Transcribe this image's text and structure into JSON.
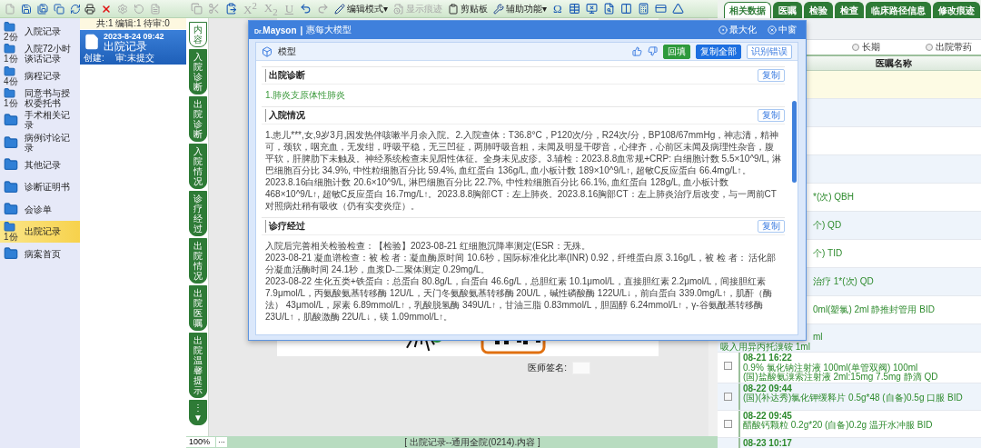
{
  "left_toolbar": [
    {
      "disabled": true
    },
    {
      "disabled": false
    },
    {
      "disabled": false
    },
    {
      "disabled": false
    },
    {
      "disabled": false
    },
    {
      "disabled": false
    },
    {
      "disabled": false
    },
    {
      "disabled": true
    },
    {
      "disabled": true
    },
    {
      "disabled": true
    }
  ],
  "sidebar": {
    "items": [
      {
        "label": "入院记录",
        "count": "2份",
        "selected": false
      },
      {
        "label": "入院72小时谈话记录",
        "count": "1份",
        "selected": false
      },
      {
        "label": "病程记录",
        "count": "4份",
        "selected": false
      },
      {
        "label": "同意书与授权委托书",
        "count": "1份",
        "selected": false
      },
      {
        "label": "手术相关记录",
        "selected": false
      },
      {
        "label": "病例讨论记录",
        "selected": false
      },
      {
        "label": "其他记录",
        "selected": false
      },
      {
        "label": "诊断证明书",
        "selected": false
      },
      {
        "label": "会诊单",
        "selected": false
      },
      {
        "label": "出院记录",
        "count": "1份",
        "selected": true
      },
      {
        "label": "病案首页",
        "selected": false
      }
    ]
  },
  "record_list": {
    "summary": "共:1 编辑:1 待审:0",
    "cards": [
      {
        "time": "2023-8-24 09:42",
        "title": "出院记录",
        "creator": "创建:",
        "status": "审:未提交",
        "selected": true
      }
    ]
  },
  "editor_toolbar": {
    "items": [
      {
        "kind": "icon",
        "disabled": true
      },
      {
        "kind": "icon",
        "disabled": true
      },
      {
        "kind": "icon",
        "disabled": false
      },
      {
        "kind": "glyph",
        "text": "X$^{2}$",
        "disabled": true
      },
      {
        "kind": "glyph",
        "text": "X$_{2}$",
        "disabled": true
      },
      {
        "kind": "glyph",
        "text": "U",
        "underlined": true,
        "disabled": true
      },
      {
        "kind": "icon",
        "disabled": false
      },
      {
        "kind": "icon",
        "disabled": true
      },
      {
        "kind": "menu",
        "text": "编辑模式",
        "arrow": "▾",
        "disabled": false
      },
      {
        "kind": "labeled",
        "text": "显示痕迹",
        "disabled": true
      },
      {
        "kind": "labeled",
        "text": "剪贴板",
        "disabled": false
      },
      {
        "kind": "menu",
        "text": "辅助功能",
        "arrow": "▾",
        "disabled": false
      },
      {
        "kind": "glyph",
        "text": "Ω",
        "disabled": false
      },
      {
        "kind": "icon",
        "disabled": false
      },
      {
        "kind": "icon",
        "disabled": false
      },
      {
        "kind": "icon",
        "disabled": false
      },
      {
        "kind": "icon",
        "disabled": false
      },
      {
        "kind": "icon",
        "disabled": false
      },
      {
        "kind": "icon",
        "disabled": false
      },
      {
        "kind": "icon",
        "disabled": false
      }
    ]
  },
  "section_tabs": [
    {
      "label": "内容",
      "selected": true
    },
    {
      "label": "入院诊断",
      "selected": false
    },
    {
      "label": "出院诊断",
      "selected": false
    },
    {
      "label": "入院情况",
      "selected": false
    },
    {
      "label": "诊疗经过",
      "selected": false
    },
    {
      "label": "出院情况",
      "selected": false
    },
    {
      "label": "出院医嘱",
      "selected": false
    },
    {
      "label": "出院温馨提示",
      "selected": false
    },
    {
      "label": "⋮▼",
      "selected": false
    }
  ],
  "document": {
    "signature_label": "医师签名:"
  },
  "status_bar": {
    "zoom": "100%",
    "zoom_menu": "···",
    "caption": "[ 出院记录--通用全院(0214).内容 ]"
  },
  "assistant": {
    "brand_prefix": "Dr.",
    "brand": "Mayson",
    "separator": "|",
    "title": "惠每大模型",
    "window_buttons": [
      {
        "label": "最大化",
        "kind": "maximize"
      },
      {
        "label": "中窗",
        "kind": "close"
      }
    ],
    "panel_title": "模型",
    "actions": [
      {
        "label": "回填",
        "kind": "fill"
      },
      {
        "label": "复制全部",
        "kind": "primary"
      },
      {
        "label": "识别错误",
        "kind": "outline"
      }
    ],
    "sections": [
      {
        "title": "出院诊断",
        "copy": "复制",
        "kind": "diagnosis",
        "paragraphs": [
          "1.肺炎支原体性肺炎"
        ]
      },
      {
        "title": "入院情况",
        "copy": "复制",
        "kind": "text",
        "paragraphs": [
          "1.患儿***,女,9岁3月,因发热伴咳嗽半月余入院。2.入院查体：T36.8°C，P120次/分，R24次/分，BP108/67mmHg，神志清，精神可，颈软，咽充血，无发绀，呼吸平稳，无三凹征，两肺呼吸音粗，未闻及明显干啰音，心律齐，心前区未闻及病理性杂音，腹平软，肝脾肋下未触及。神经系统检查未见阳性体征。全身未见皮疹。3.辅检：2023.8.8血常规+CRP: 白细胞计数 5.5×10^9/L, 淋巴细胞百分比 34.9%, 中性粒细胞百分比 59.4%, 血红蛋白 136g/L, 血小板计数 189×10^9/L↑, 超敏C反应蛋白 66.4mg/L↑。2023.8.16白细胞计数 20.6×10^9/L, 淋巴细胞百分比 22.7%, 中性粒细胞百分比 66.1%, 血红蛋白 128g/L, 血小板计数 468×10^9/L↑, 超敏C反应蛋白 16.7mg/L↑。2023.8.8胸部CT：左上肺炎。2023.8.16胸部CT：左上肺炎治疗后改变，与一周前CT对照病灶稍有吸收（仍有实变炎症）。"
        ]
      },
      {
        "title": "诊疗经过",
        "copy": "复制",
        "kind": "text",
        "paragraphs": [
          "入院后完善相关检验检查：【检验】2023-08-21 红细胞沉降率测定(ESR：无殊。",
          "2023-08-21 凝血谱检查：被 检 者：凝血酶原时间 10.6秒，国际标准化比率(INR) 0.92，纤维蛋白原 3.16g/L，被 检 者： 活化部分凝血活酶时间 24.1秒，血浆D-二聚体测定 0.29mg/L。",
          "2023-08-22 生化五类+铁蛋白：总蛋白 80.8g/L，白蛋白 46.6g/L，总胆红素 10.1μmol/L，直接胆红素 2.2μmol/L，间接胆红素 7.9μmol/L，丙氨酸氨基转移酶 12U/L，天门冬氨酸氨基转移酶 20U/L，碱性磷酸酶 122U/L↓，前白蛋白 339.0mg/L↑，肌酐（酶法） 43μmol/L，尿素 6.89mmol/L↑，乳酸脱氢酶 349U/L↑，甘油三脂 0.83mmol/L，胆固醇 6.24mmol/L↑，γ-谷氨酰基转移酶 23U/L↑，肌酸激酶 22U/L↓，镁 1.09mmol/L↑。"
        ]
      }
    ]
  },
  "right_panel": {
    "tabs": [
      {
        "label": "相关数据",
        "selected": true
      },
      {
        "label": "医嘱",
        "selected": false
      },
      {
        "label": "检验",
        "selected": false
      },
      {
        "label": "检查",
        "selected": false
      },
      {
        "label": "临床路径信息",
        "selected": false
      },
      {
        "label": "修改痕迹",
        "selected": false
      }
    ],
    "filters": [
      {
        "label": "长期",
        "selected": false
      },
      {
        "label": "出院带药",
        "selected": false
      }
    ],
    "column": "医嘱名称",
    "rows": [
      {
        "kind": "empty",
        "highlighted": true
      },
      {
        "kind": "empty",
        "highlighted": false
      },
      {
        "kind": "empty",
        "highlighted": false
      },
      {
        "kind": "empty",
        "highlighted": false
      },
      {
        "kind": "partial",
        "lines": [
          "*(次) QBH"
        ]
      },
      {
        "kind": "partial",
        "lines": [
          "个) QD"
        ]
      },
      {
        "kind": "partial",
        "lines": [
          "个) TID"
        ]
      },
      {
        "kind": "partial",
        "lines": [
          "治疗 1*(次) QD"
        ]
      },
      {
        "kind": "partial",
        "lines": [
          "0ml(塑氯) 2ml 静推封管用 BID"
        ]
      },
      {
        "kind": "split",
        "lines": [
          "ml",
          "吸入用异丙托溴铵 1ml"
        ]
      },
      {
        "kind": "entry",
        "checked": false,
        "time": "08-21 16:22",
        "lines": [
          "0.9% 氯化钠注射液 100ml(单管双阀) 100ml",
          "(国)盐酸氨溴索注射液 2ml:15mg 7.5mg 静滴 QD"
        ]
      },
      {
        "kind": "entry",
        "checked": false,
        "time": "08-22 09:44",
        "lines": [
          "(国)(补达秀)氯化钾缓释片 0.5g*48 (自备)0.5g 口服 BID"
        ]
      },
      {
        "kind": "entry",
        "checked": false,
        "time": "08-22 09:45",
        "lines": [
          "醋酸钙颗粒 0.2g*20 (自备)0.2g 温开水冲服 BID"
        ]
      },
      {
        "kind": "entry",
        "time": "08-23 10:17",
        "lines": []
      }
    ]
  }
}
